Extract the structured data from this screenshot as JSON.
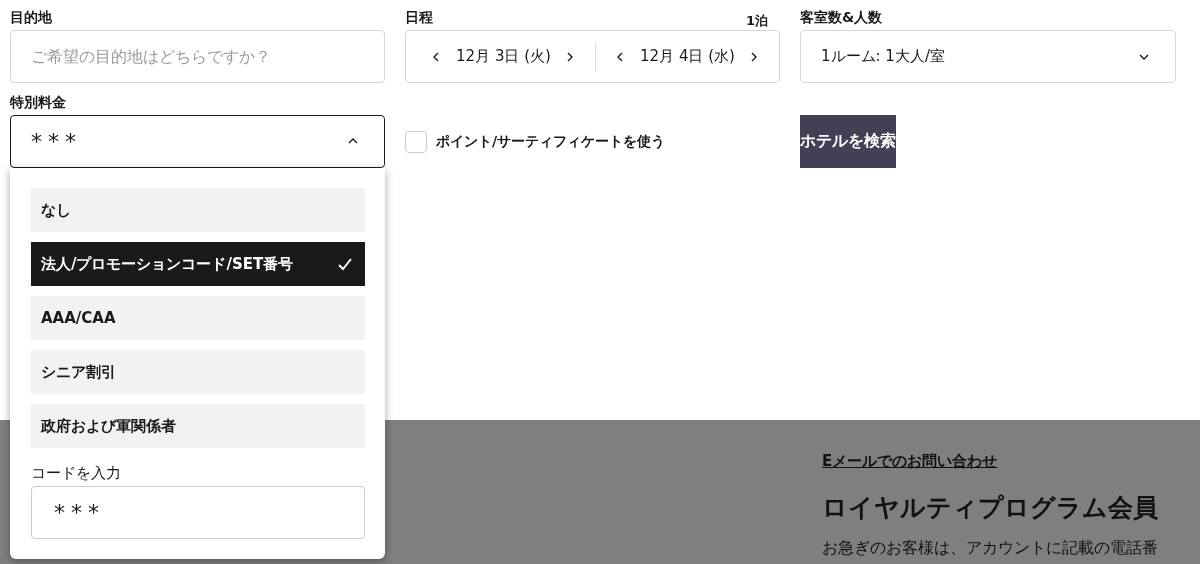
{
  "destination": {
    "label": "目的地",
    "placeholder": "ご希望の目的地はどちらですか？"
  },
  "dates": {
    "label": "日程",
    "nights": "1泊",
    "check_in": "12月 3日 (火)",
    "check_out": "12月 4日 (水)"
  },
  "rooms": {
    "label": "客室数&人数",
    "value": "1ルーム: 1大人/室",
    "expanded": false
  },
  "special_rate": {
    "label": "特別料金",
    "value": "***",
    "expanded": true,
    "options": [
      {
        "label": "なし",
        "selected": false
      },
      {
        "label": "法人/プロモーションコード/SET番号",
        "selected": true
      },
      {
        "label": "AAA/CAA",
        "selected": false
      },
      {
        "label": "シニア割引",
        "selected": false
      },
      {
        "label": "政府および軍関係者",
        "selected": false
      }
    ],
    "code_label": "コードを入力",
    "code_value": "***"
  },
  "points_checkbox": {
    "label": "ポイント/サーティフィケートを使う",
    "checked": false
  },
  "search_button": "ホテルを検索",
  "background": {
    "email_link": "Eメールでのお問い合わせ",
    "heading": "ロイヤルティプログラム会員",
    "text": "お急ぎのお客様は、アカウントに記載の電話番"
  }
}
